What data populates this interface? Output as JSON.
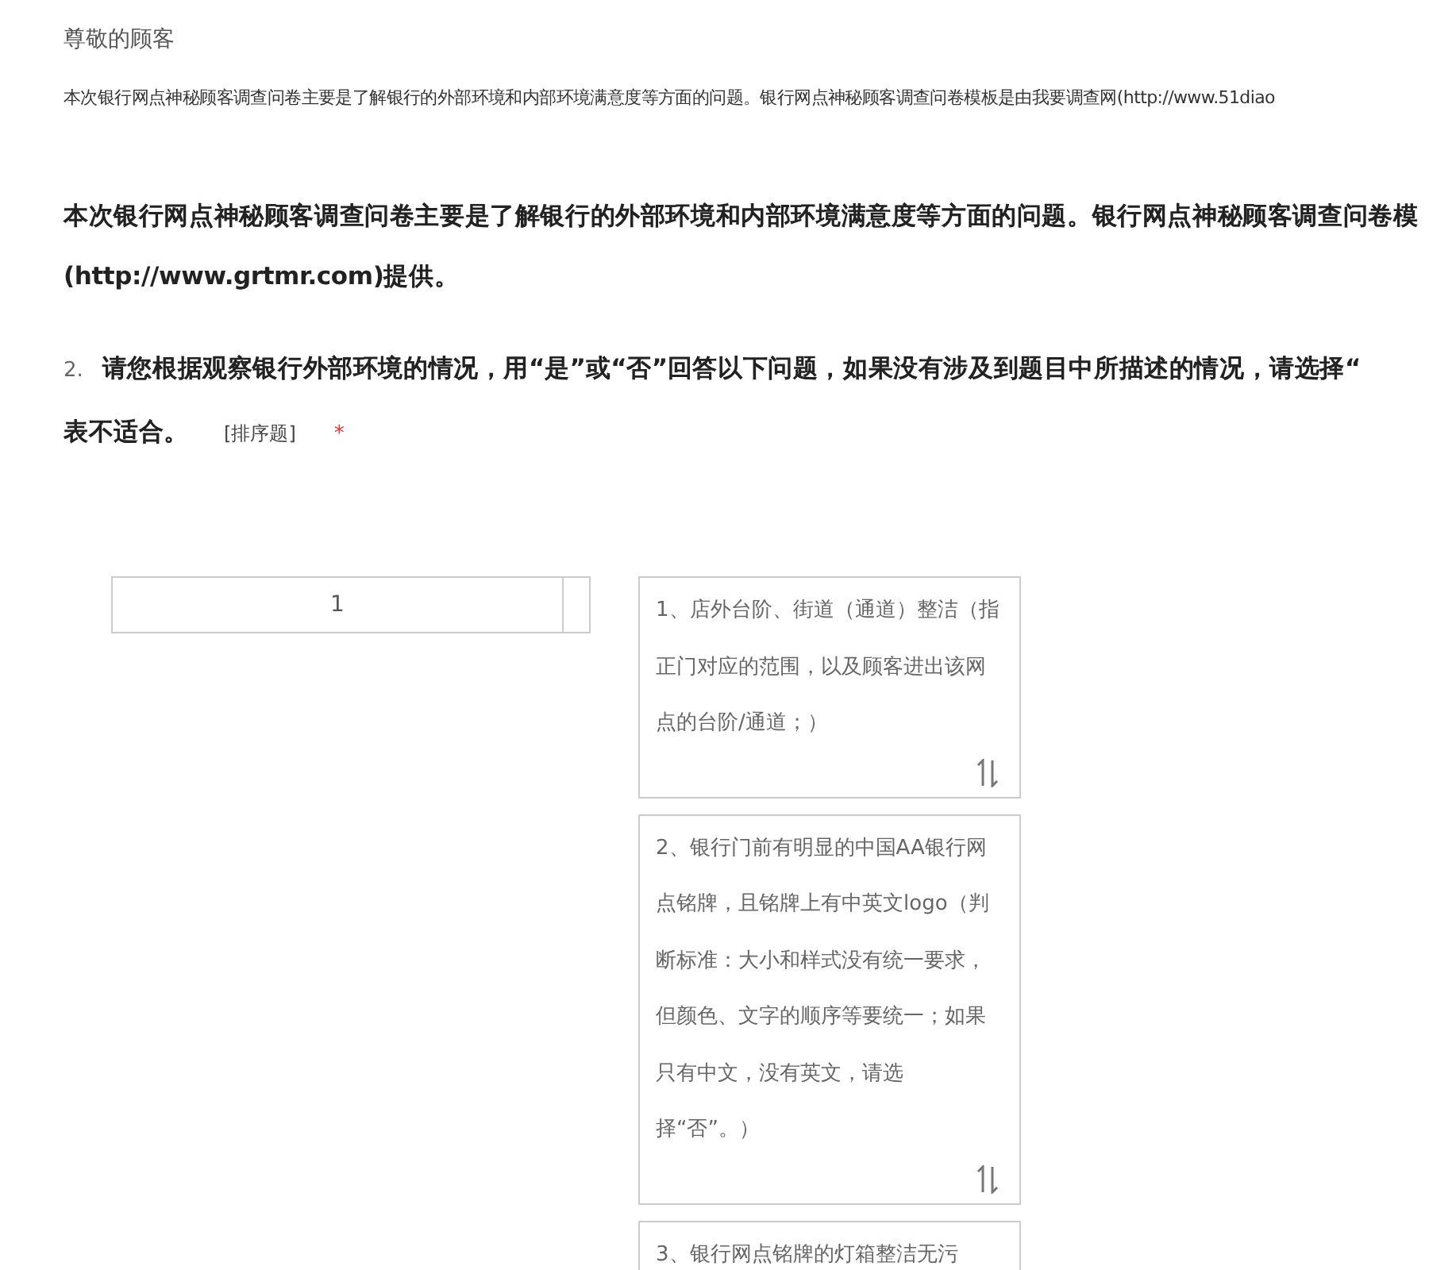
{
  "greeting": "尊敬的顾客",
  "intro_small": "本次银行网点神秘顾客调查问卷主要是了解银行的外部环境和内部环境满意度等方面的问题。银行网点神秘顾客调查问卷模板是由我要调查网(http://www.51diao",
  "intro_bold": [
    "本次银行网点神秘顾客调查问卷主要是了解银行的外部环境和内部环境满意度等方面的问题。银行网点神秘顾客调查问卷模",
    "(http://www.grtmr.com)提供。"
  ],
  "question": {
    "number": "2.",
    "lines": [
      "请您根据观察银行外部环境的情况，用“是”或“否”回答以下问题，如果没有涉及到题目中所描述的情况，请选择“",
      "表不适合。"
    ],
    "type_tag": "[排序题]",
    "required_mark": "*",
    "rank_slots": [
      {
        "value": "1"
      }
    ],
    "options": [
      {
        "text": "1、店外台阶、街道（通道）整洁（指正门对应的范围，以及顾客进出该网点的台阶/通道；）",
        "full": true
      },
      {
        "text": "2、银行门前有明显的中国AA银行网点铭牌，且铭牌上有中英文logo（判断标准：大小和样式没有统一要求，但颜色、文字的顺序等要统一；如果只有中文，没有英文，请选择“否”。）",
        "full": true
      },
      {
        "text": "3、银行网点铭牌的灯箱整洁无污",
        "full": false
      }
    ]
  }
}
